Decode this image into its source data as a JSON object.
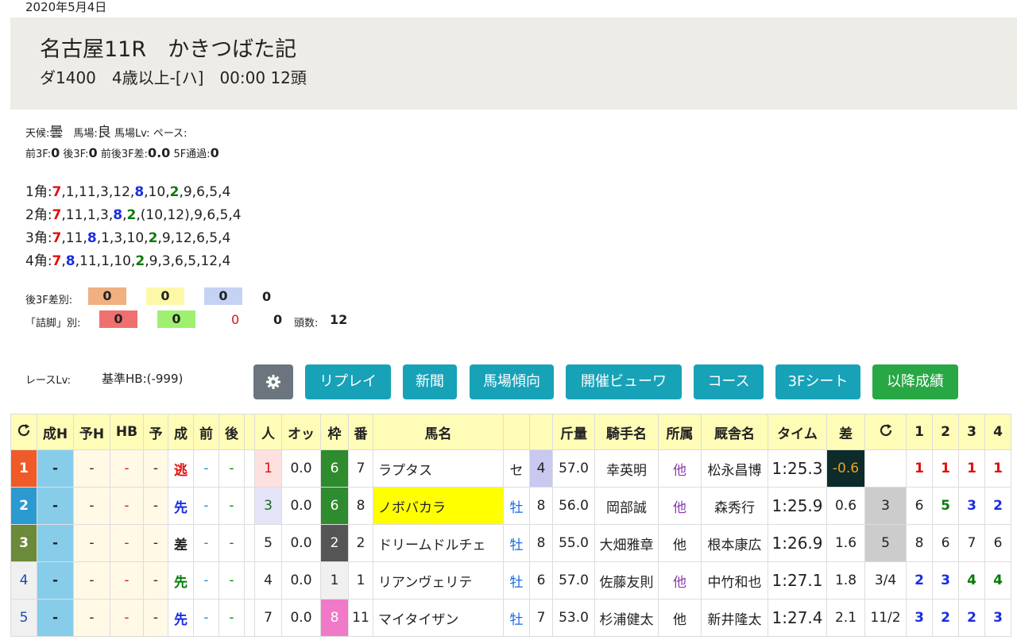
{
  "date": "2020年5月4日",
  "race": {
    "title": "名古屋11R　かきつばた記",
    "subtitle": "ダ1400　4歳以上-[ハ]　00:00 12頭"
  },
  "conditions": {
    "weather_label": "天候:",
    "weather": "曇",
    "track_label": "馬場:",
    "track": "良",
    "track_lv_label": "馬場Lv:",
    "pace_label": "ペース:",
    "f3_front_label": "前3F:",
    "f3_front": "0",
    "f3_back_label": "後3F:",
    "f3_back": "0",
    "f3_diff_label": "前後3F差:",
    "f3_diff": "0.0",
    "f5_label": "5F通過:",
    "f5": "0"
  },
  "corners": [
    {
      "label": "1角:",
      "tokens": [
        {
          "t": "7",
          "c": "r"
        },
        {
          "t": ",1,11,3,12,",
          "c": ""
        },
        {
          "t": "8",
          "c": "b"
        },
        {
          "t": ",10,",
          "c": ""
        },
        {
          "t": "2",
          "c": "g"
        },
        {
          "t": ",9,6,5,4",
          "c": ""
        }
      ]
    },
    {
      "label": "2角:",
      "tokens": [
        {
          "t": "7",
          "c": "r"
        },
        {
          "t": ",11,1,3,",
          "c": ""
        },
        {
          "t": "8",
          "c": "b"
        },
        {
          "t": ",",
          "c": ""
        },
        {
          "t": "2",
          "c": "g"
        },
        {
          "t": ",(10,12),9,6,5,4",
          "c": ""
        }
      ]
    },
    {
      "label": "3角:",
      "tokens": [
        {
          "t": "7",
          "c": "r"
        },
        {
          "t": ",11,",
          "c": ""
        },
        {
          "t": "8",
          "c": "b"
        },
        {
          "t": ",1,3,10,",
          "c": ""
        },
        {
          "t": "2",
          "c": "g"
        },
        {
          "t": ",9,12,6,5,4",
          "c": ""
        }
      ]
    },
    {
      "label": "4角:",
      "tokens": [
        {
          "t": "7",
          "c": "r"
        },
        {
          "t": ",",
          "c": ""
        },
        {
          "t": "8",
          "c": "b"
        },
        {
          "t": ",11,1,10,",
          "c": ""
        },
        {
          "t": "2",
          "c": "g"
        },
        {
          "t": ",9,3,6,5,12,4",
          "c": ""
        }
      ]
    }
  ],
  "diff3f": {
    "label": "後3F差別:",
    "values": [
      "0",
      "0",
      "0",
      "0"
    ],
    "colors": [
      "#f0b080",
      "#fdf8a8",
      "#c4d2f4"
    ]
  },
  "tsume": {
    "label": "「詰脚」別:",
    "values": [
      "0",
      "0",
      "0",
      "0"
    ],
    "colors": [
      "#f07070",
      "#a0f070"
    ],
    "count_label": "頭数:",
    "count": "12"
  },
  "race_lv": {
    "label": "レースLv:",
    "base_hb": "基準HB:(-999)"
  },
  "buttons": [
    "リプレイ",
    "新聞",
    "馬場傾向",
    "開催ビューワ",
    "コース",
    "3Fシート",
    "以降成績"
  ],
  "table": {
    "headers": [
      "C",
      "成H",
      "予H",
      "HB",
      "予",
      "成",
      "前",
      "後",
      "",
      "人",
      "オッ",
      "枠",
      "番",
      "馬名",
      "",
      "",
      "斤量",
      "騎手名",
      "所属",
      "厩舎名",
      "タイム",
      "差",
      "C",
      "1",
      "2",
      "3",
      "4"
    ],
    "rows": [
      {
        "rank": "1",
        "rank_color": "#f05a28",
        "seiH": "-",
        "yoH": "-",
        "hb": "-",
        "yo": "-",
        "sei": "逃",
        "sei_color": "#e01010",
        "mae": "-",
        "ushiro": "-",
        "ninki": "1",
        "ninki_bg": "#fde0e0",
        "odds": "0.0",
        "waku": "6",
        "waku_bg": "#2e8b2e",
        "ban": "7",
        "name": "ラプタス",
        "name_bg": "",
        "sex": "セ",
        "sex_color": "#222",
        "age": "4",
        "age_bg": "#c8c8f0",
        "kinryo": "57.0",
        "jockey": "幸英明",
        "shozoku": "他",
        "trainer": "松永昌博",
        "time": "1:25.3",
        "sa": "-0.6",
        "sa_bg": "#0d2b2b",
        "sa_color": "#f0a020",
        "c2": "",
        "c2_bg": "",
        "p1": "1",
        "p1c": "r",
        "p2": "1",
        "p2c": "r",
        "p3": "1",
        "p3c": "r",
        "p4": "1",
        "p4c": "r"
      },
      {
        "rank": "2",
        "rank_color": "#2a9ad0",
        "seiH": "-",
        "yoH": "-",
        "hb": "-",
        "yo": "-",
        "sei": "先",
        "sei_color": "#1a2ee0",
        "mae": "-",
        "ushiro": "-",
        "ninki": "3",
        "ninki_bg": "#e4e4f8",
        "odds": "0.0",
        "waku": "6",
        "waku_bg": "#2e8b2e",
        "ban": "8",
        "name": "ノボバカラ",
        "name_bg": "#ffff00",
        "sex": "牡",
        "sex_color": "#1a6ae0",
        "age": "8",
        "age_bg": "",
        "kinryo": "56.0",
        "jockey": "岡部誠",
        "shozoku": "他",
        "trainer": "森秀行",
        "time": "1:25.9",
        "sa": "0.6",
        "sa_bg": "",
        "sa_color": "#222",
        "c2": "3",
        "c2_bg": "#cccccc",
        "p1": "6",
        "p1c": "",
        "p2": "5",
        "p2c": "g",
        "p3": "3",
        "p3c": "b",
        "p4": "2",
        "p4c": "b"
      },
      {
        "rank": "3",
        "rank_color": "#6b8a3a",
        "seiH": "-",
        "yoH": "-",
        "hb": "-",
        "yo": "-",
        "sei": "差",
        "sei_color": "#222",
        "mae": "-",
        "ushiro": "-",
        "ninki": "5",
        "ninki_bg": "",
        "odds": "0.0",
        "waku": "2",
        "waku_bg": "#555555",
        "ban": "2",
        "name": "ドリームドルチェ",
        "name_bg": "",
        "sex": "牡",
        "sex_color": "#1a6ae0",
        "age": "8",
        "age_bg": "",
        "kinryo": "55.0",
        "jockey": "大畑雅章",
        "shozoku": "他",
        "trainer": "根本康広",
        "time": "1:26.9",
        "sa": "1.6",
        "sa_bg": "",
        "sa_color": "#222",
        "c2": "5",
        "c2_bg": "#cccccc",
        "p1": "8",
        "p1c": "",
        "p2": "6",
        "p2c": "",
        "p3": "7",
        "p3c": "",
        "p4": "6",
        "p4c": ""
      },
      {
        "rank": "4",
        "rank_color": "",
        "seiH": "-",
        "yoH": "-",
        "hb": "-",
        "yo": "-",
        "sei": "先",
        "sei_color": "#0a7a0a",
        "mae": "-",
        "ushiro": "-",
        "ninki": "4",
        "ninki_bg": "",
        "odds": "0.0",
        "waku": "1",
        "waku_bg": "#f0f0f0",
        "ban": "1",
        "name": "リアンヴェリテ",
        "name_bg": "",
        "sex": "牡",
        "sex_color": "#1a6ae0",
        "age": "6",
        "age_bg": "",
        "kinryo": "57.0",
        "jockey": "佐藤友則",
        "shozoku": "他",
        "trainer": "中竹和也",
        "time": "1:27.1",
        "sa": "1.8",
        "sa_bg": "",
        "sa_color": "#222",
        "c2": "3/4",
        "c2_bg": "",
        "p1": "2",
        "p1c": "b",
        "p2": "3",
        "p2c": "b",
        "p3": "4",
        "p3c": "g",
        "p4": "4",
        "p4c": "g"
      },
      {
        "rank": "5",
        "rank_color": "",
        "seiH": "-",
        "yoH": "-",
        "hb": "-",
        "yo": "-",
        "sei": "先",
        "sei_color": "#1a2ee0",
        "mae": "-",
        "ushiro": "-",
        "ninki": "7",
        "ninki_bg": "",
        "odds": "0.0",
        "waku": "8",
        "waku_bg": "#f07ac8",
        "ban": "11",
        "name": "マイタイザン",
        "name_bg": "",
        "sex": "牡",
        "sex_color": "#1a6ae0",
        "age": "7",
        "age_bg": "",
        "kinryo": "53.0",
        "jockey": "杉浦健太",
        "shozoku": "他",
        "trainer": "新井隆太",
        "time": "1:27.4",
        "sa": "2.1",
        "sa_bg": "",
        "sa_color": "#222",
        "c2": "11/2",
        "c2_bg": "",
        "p1": "3",
        "p1c": "b",
        "p2": "2",
        "p2c": "b",
        "p3": "2",
        "p3c": "b",
        "p4": "3",
        "p4c": "b"
      }
    ]
  }
}
